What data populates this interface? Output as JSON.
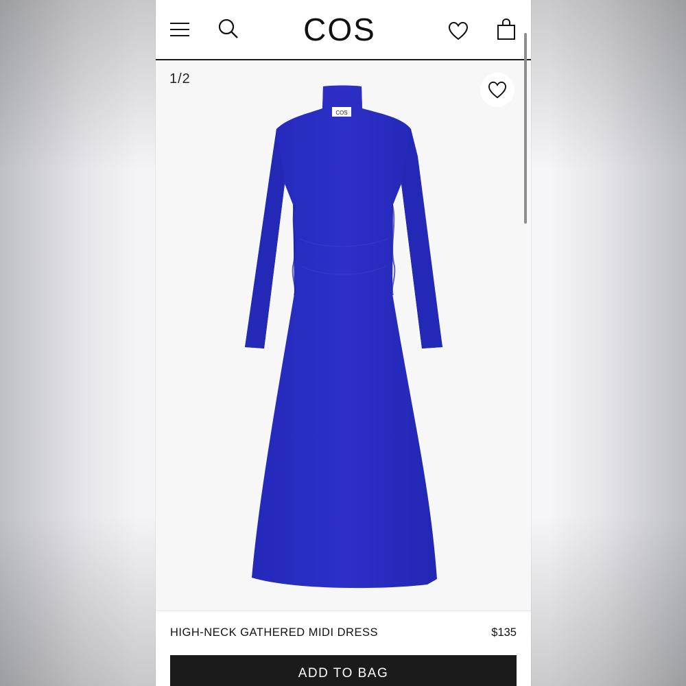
{
  "brand": {
    "logo_text": "COS"
  },
  "header": {
    "menu_icon": "hamburger-menu-icon",
    "search_icon": "search-icon",
    "wishlist_icon": "heart-icon",
    "bag_icon": "shopping-bag-icon"
  },
  "gallery": {
    "counter": "1/2",
    "favorite_icon": "heart-icon",
    "image_label": "COS",
    "dress_color": "#2c2fc4"
  },
  "product": {
    "name": "HIGH-NECK GATHERED MIDI DRESS",
    "price": "$135"
  },
  "actions": {
    "add_to_bag_label": "ADD TO BAG"
  },
  "colors": {
    "accent": "#1b1b1b",
    "background": "#ffffff",
    "dress": "#2c2fc4"
  }
}
